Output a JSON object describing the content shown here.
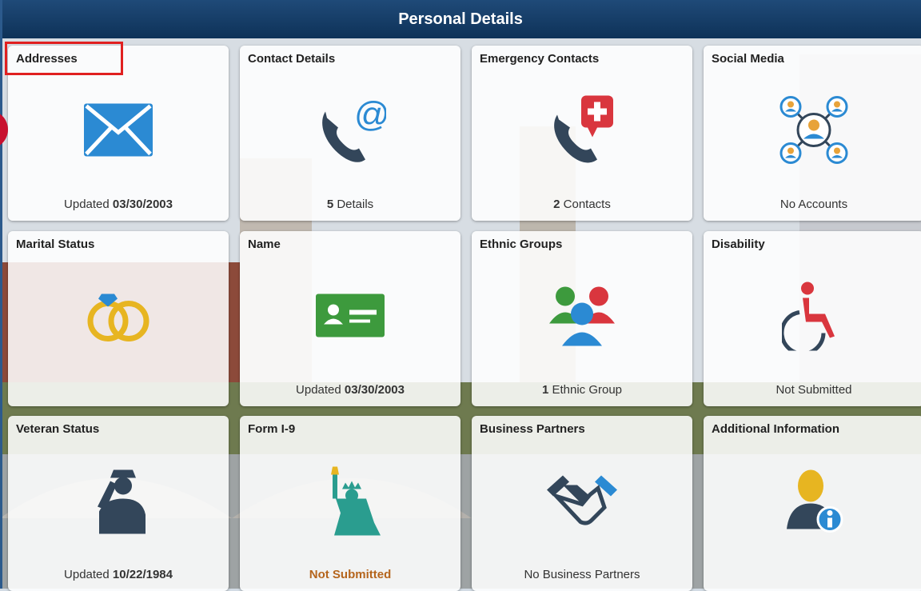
{
  "header": {
    "title": "Personal Details"
  },
  "tiles": [
    {
      "title": "Addresses",
      "foot_text": "Updated ",
      "foot_bold": "03/30/2003",
      "icon": "envelope-icon"
    },
    {
      "title": "Contact Details",
      "foot_bold": "5",
      "foot_text": " Details",
      "icon": "phone-at-icon"
    },
    {
      "title": "Emergency Contacts",
      "foot_bold": "2",
      "foot_text": " Contacts",
      "icon": "phone-medical-icon"
    },
    {
      "title": "Social Media",
      "foot_text": "No Accounts",
      "icon": "social-network-icon"
    },
    {
      "title": "Marital Status",
      "icon": "wedding-rings-icon"
    },
    {
      "title": "Name",
      "foot_text": "Updated ",
      "foot_bold": "03/30/2003",
      "icon": "id-card-icon"
    },
    {
      "title": "Ethnic Groups",
      "foot_bold": "1",
      "foot_text": " Ethnic Group",
      "icon": "people-group-icon"
    },
    {
      "title": "Disability",
      "foot_text": "Not Submitted",
      "icon": "wheelchair-icon"
    },
    {
      "title": "Veteran Status",
      "foot_text": "Updated ",
      "foot_bold": "10/22/1984",
      "icon": "saluting-soldier-icon"
    },
    {
      "title": "Form I-9",
      "foot_warn": "Not Submitted",
      "icon": "statue-of-liberty-icon"
    },
    {
      "title": "Business Partners",
      "foot_text": "No Business Partners",
      "icon": "handshake-icon"
    },
    {
      "title": "Additional Information",
      "icon": "person-info-icon"
    }
  ],
  "colors": {
    "header": "#1f4a78",
    "accent_red": "#e02020",
    "warn": "#b5651d"
  }
}
